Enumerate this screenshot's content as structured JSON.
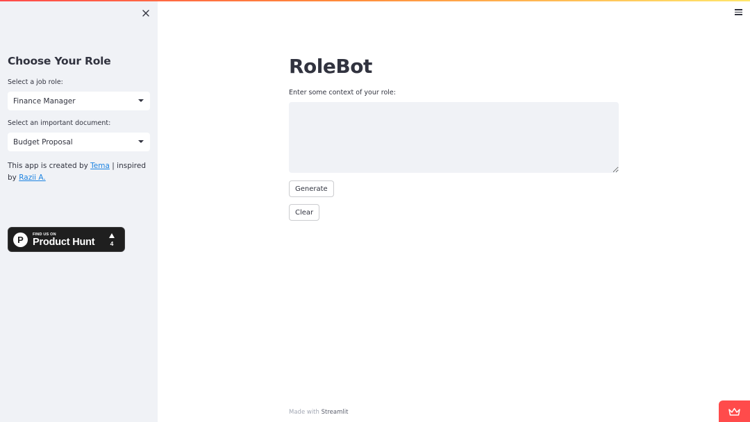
{
  "sidebar": {
    "title": "Choose Your Role",
    "job_role_label": "Select a job role:",
    "job_role_value": "Finance Manager",
    "document_label": "Select an important document:",
    "document_value": "Budget Proposal",
    "credit_prefix": "This app is created by ",
    "credit_author": "Tema",
    "credit_middle": " | inspired by ",
    "credit_inspiration": "Razii A.",
    "product_hunt": {
      "find_text": "FIND US ON",
      "name": "Product Hunt",
      "logo_letter": "P",
      "upvotes": "4"
    }
  },
  "main": {
    "title": "RoleBot",
    "context_label": "Enter some context of your role:",
    "context_value": "",
    "generate_label": "Generate",
    "clear_label": "Clear"
  },
  "footer": {
    "made_with": "Made with",
    "brand": "Streamlit"
  },
  "colors": {
    "accent": "#ff4b4b",
    "link": "#1c83e1",
    "sidebar_bg": "#f0f2f6",
    "text": "#31333f"
  },
  "icons": {
    "close": "close-icon",
    "menu": "hamburger-menu-icon",
    "dropdown": "chevron-down-icon",
    "upvote": "upvote-triangle-icon",
    "deploy": "streamlit-crown-icon"
  }
}
